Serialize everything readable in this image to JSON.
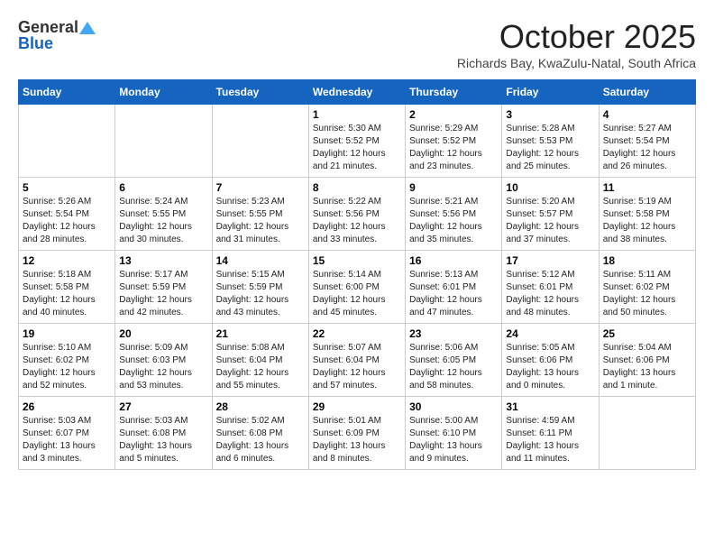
{
  "header": {
    "logo_general": "General",
    "logo_blue": "Blue",
    "month_title": "October 2025",
    "subtitle": "Richards Bay, KwaZulu-Natal, South Africa"
  },
  "days_of_week": [
    "Sunday",
    "Monday",
    "Tuesday",
    "Wednesday",
    "Thursday",
    "Friday",
    "Saturday"
  ],
  "weeks": [
    [
      {
        "day": "",
        "details": ""
      },
      {
        "day": "",
        "details": ""
      },
      {
        "day": "",
        "details": ""
      },
      {
        "day": "1",
        "details": "Sunrise: 5:30 AM\nSunset: 5:52 PM\nDaylight: 12 hours\nand 21 minutes."
      },
      {
        "day": "2",
        "details": "Sunrise: 5:29 AM\nSunset: 5:52 PM\nDaylight: 12 hours\nand 23 minutes."
      },
      {
        "day": "3",
        "details": "Sunrise: 5:28 AM\nSunset: 5:53 PM\nDaylight: 12 hours\nand 25 minutes."
      },
      {
        "day": "4",
        "details": "Sunrise: 5:27 AM\nSunset: 5:54 PM\nDaylight: 12 hours\nand 26 minutes."
      }
    ],
    [
      {
        "day": "5",
        "details": "Sunrise: 5:26 AM\nSunset: 5:54 PM\nDaylight: 12 hours\nand 28 minutes."
      },
      {
        "day": "6",
        "details": "Sunrise: 5:24 AM\nSunset: 5:55 PM\nDaylight: 12 hours\nand 30 minutes."
      },
      {
        "day": "7",
        "details": "Sunrise: 5:23 AM\nSunset: 5:55 PM\nDaylight: 12 hours\nand 31 minutes."
      },
      {
        "day": "8",
        "details": "Sunrise: 5:22 AM\nSunset: 5:56 PM\nDaylight: 12 hours\nand 33 minutes."
      },
      {
        "day": "9",
        "details": "Sunrise: 5:21 AM\nSunset: 5:56 PM\nDaylight: 12 hours\nand 35 minutes."
      },
      {
        "day": "10",
        "details": "Sunrise: 5:20 AM\nSunset: 5:57 PM\nDaylight: 12 hours\nand 37 minutes."
      },
      {
        "day": "11",
        "details": "Sunrise: 5:19 AM\nSunset: 5:58 PM\nDaylight: 12 hours\nand 38 minutes."
      }
    ],
    [
      {
        "day": "12",
        "details": "Sunrise: 5:18 AM\nSunset: 5:58 PM\nDaylight: 12 hours\nand 40 minutes."
      },
      {
        "day": "13",
        "details": "Sunrise: 5:17 AM\nSunset: 5:59 PM\nDaylight: 12 hours\nand 42 minutes."
      },
      {
        "day": "14",
        "details": "Sunrise: 5:15 AM\nSunset: 5:59 PM\nDaylight: 12 hours\nand 43 minutes."
      },
      {
        "day": "15",
        "details": "Sunrise: 5:14 AM\nSunset: 6:00 PM\nDaylight: 12 hours\nand 45 minutes."
      },
      {
        "day": "16",
        "details": "Sunrise: 5:13 AM\nSunset: 6:01 PM\nDaylight: 12 hours\nand 47 minutes."
      },
      {
        "day": "17",
        "details": "Sunrise: 5:12 AM\nSunset: 6:01 PM\nDaylight: 12 hours\nand 48 minutes."
      },
      {
        "day": "18",
        "details": "Sunrise: 5:11 AM\nSunset: 6:02 PM\nDaylight: 12 hours\nand 50 minutes."
      }
    ],
    [
      {
        "day": "19",
        "details": "Sunrise: 5:10 AM\nSunset: 6:02 PM\nDaylight: 12 hours\nand 52 minutes."
      },
      {
        "day": "20",
        "details": "Sunrise: 5:09 AM\nSunset: 6:03 PM\nDaylight: 12 hours\nand 53 minutes."
      },
      {
        "day": "21",
        "details": "Sunrise: 5:08 AM\nSunset: 6:04 PM\nDaylight: 12 hours\nand 55 minutes."
      },
      {
        "day": "22",
        "details": "Sunrise: 5:07 AM\nSunset: 6:04 PM\nDaylight: 12 hours\nand 57 minutes."
      },
      {
        "day": "23",
        "details": "Sunrise: 5:06 AM\nSunset: 6:05 PM\nDaylight: 12 hours\nand 58 minutes."
      },
      {
        "day": "24",
        "details": "Sunrise: 5:05 AM\nSunset: 6:06 PM\nDaylight: 13 hours\nand 0 minutes."
      },
      {
        "day": "25",
        "details": "Sunrise: 5:04 AM\nSunset: 6:06 PM\nDaylight: 13 hours\nand 1 minute."
      }
    ],
    [
      {
        "day": "26",
        "details": "Sunrise: 5:03 AM\nSunset: 6:07 PM\nDaylight: 13 hours\nand 3 minutes."
      },
      {
        "day": "27",
        "details": "Sunrise: 5:03 AM\nSunset: 6:08 PM\nDaylight: 13 hours\nand 5 minutes."
      },
      {
        "day": "28",
        "details": "Sunrise: 5:02 AM\nSunset: 6:08 PM\nDaylight: 13 hours\nand 6 minutes."
      },
      {
        "day": "29",
        "details": "Sunrise: 5:01 AM\nSunset: 6:09 PM\nDaylight: 13 hours\nand 8 minutes."
      },
      {
        "day": "30",
        "details": "Sunrise: 5:00 AM\nSunset: 6:10 PM\nDaylight: 13 hours\nand 9 minutes."
      },
      {
        "day": "31",
        "details": "Sunrise: 4:59 AM\nSunset: 6:11 PM\nDaylight: 13 hours\nand 11 minutes."
      },
      {
        "day": "",
        "details": ""
      }
    ]
  ]
}
